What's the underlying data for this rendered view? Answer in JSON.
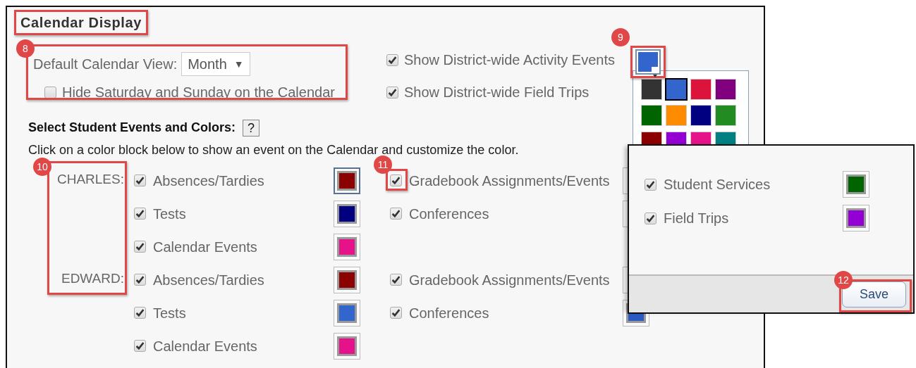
{
  "title": "Calendar Display",
  "view": {
    "label": "Default Calendar View:",
    "value": "Month",
    "caret": "▼"
  },
  "hide_weekend": {
    "label": "Hide Saturday and Sunday on the Calendar",
    "checked": false
  },
  "district": [
    {
      "label": "Show District-wide Activity Events",
      "checked": true
    },
    {
      "label": "Show District-wide Field Trips",
      "checked": true
    }
  ],
  "color_button": {
    "color": "#3366cc",
    "expanded": true
  },
  "palette": [
    {
      "color": "#333333",
      "selected": false
    },
    {
      "color": "#3366cc",
      "selected": true
    },
    {
      "color": "#dc143c",
      "selected": false
    },
    {
      "color": "#800080",
      "selected": false
    },
    {
      "color": "#006400",
      "selected": false
    },
    {
      "color": "#ff8c00",
      "selected": false
    },
    {
      "color": "#000080",
      "selected": false
    },
    {
      "color": "#228b22",
      "selected": false
    },
    {
      "color": "#8b0000",
      "selected": false
    },
    {
      "color": "#9400d3",
      "selected": false
    },
    {
      "color": "#e6128a",
      "selected": false
    },
    {
      "color": "#008080",
      "selected": false
    }
  ],
  "section_heading": "Select Student Events and Colors:",
  "help": "?",
  "instructions": "Click on a color block below to show an event on the Calendar and customize the color.",
  "students": [
    {
      "name": "CHARLES:",
      "rows": [
        {
          "items": [
            {
              "label": "Absences/Tardies",
              "checked": true,
              "color": "#8b0000",
              "selected": true
            },
            {
              "label": "Gradebook Assignments/Events",
              "checked": true,
              "selected": false
            }
          ]
        },
        {
          "items": [
            {
              "label": "Tests",
              "checked": true,
              "color": "#000080",
              "selected": false
            },
            {
              "label": "Conferences",
              "checked": true,
              "selected": false
            }
          ]
        },
        {
          "items": [
            {
              "label": "Calendar Events",
              "checked": true,
              "color": "#e6128a",
              "selected": false
            }
          ]
        }
      ]
    },
    {
      "name": "EDWARD:",
      "rows": [
        {
          "items": [
            {
              "label": "Absences/Tardies",
              "checked": true,
              "color": "#8b0000",
              "selected": false
            },
            {
              "label": "Gradebook Assignments/Events",
              "checked": true,
              "selected": false
            }
          ]
        },
        {
          "items": [
            {
              "label": "Tests",
              "checked": true,
              "color": "#3366cc",
              "selected": false
            },
            {
              "label": "Conferences",
              "checked": true,
              "color": "#2a5bc4",
              "selected": false
            }
          ]
        },
        {
          "items": [
            {
              "label": "Calendar Events",
              "checked": true,
              "color": "#e6128a",
              "selected": false
            }
          ]
        }
      ]
    }
  ],
  "popup": {
    "items": [
      {
        "label": "Student Services",
        "checked": true,
        "color": "#006400"
      },
      {
        "label": "Field Trips",
        "checked": true,
        "color": "#9400d3"
      }
    ],
    "save": "Save"
  },
  "callouts": [
    {
      "kind": "box"
    },
    {
      "kind": "numbered",
      "number": "8"
    },
    {
      "kind": "numbered",
      "number": "9"
    },
    {
      "kind": "numbered",
      "number": "10"
    },
    {
      "kind": "numbered",
      "number": "11"
    },
    {
      "kind": "numbered",
      "number": "12"
    }
  ]
}
